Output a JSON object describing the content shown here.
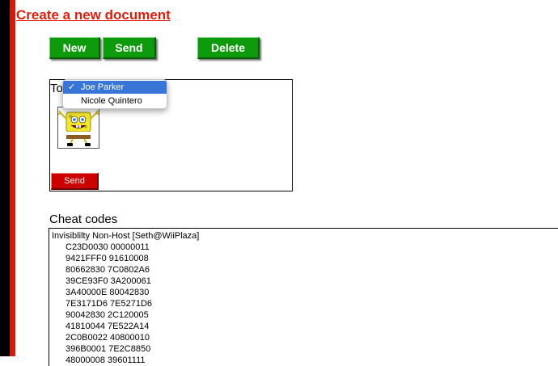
{
  "page": {
    "title": "Create a new document"
  },
  "toolbar": {
    "new_label": "New",
    "send_label": "Send",
    "delete_label": "Delete"
  },
  "compose": {
    "to_label": "To",
    "recipient_options": [
      "Joe Parker",
      "Nicole Quintero"
    ],
    "selected_recipient": "Joe Parker",
    "send_label": "Send"
  },
  "cheat_codes": {
    "heading": "Cheat codes",
    "title_line": "Invisiblilty Non-Host [Seth@WiiPlaza]",
    "lines": [
      "C23D0030 00000011",
      "9421FFF0 91610008",
      "80662830 7C0802A6",
      "39CE93F0 3A200061",
      "3A40000E 80042830",
      "7E3171D6 7E5271D6",
      "90042830 2C120005",
      "41810044 7E522A14",
      "2C0B0022 40800010",
      "396B0001 7E2C8850",
      "48000008 39601111"
    ]
  },
  "colors": {
    "accent_red": "#d21c0b",
    "button_green": "#0d9a0d",
    "send_red": "#cc0000",
    "selection_blue": "#3875d7"
  }
}
